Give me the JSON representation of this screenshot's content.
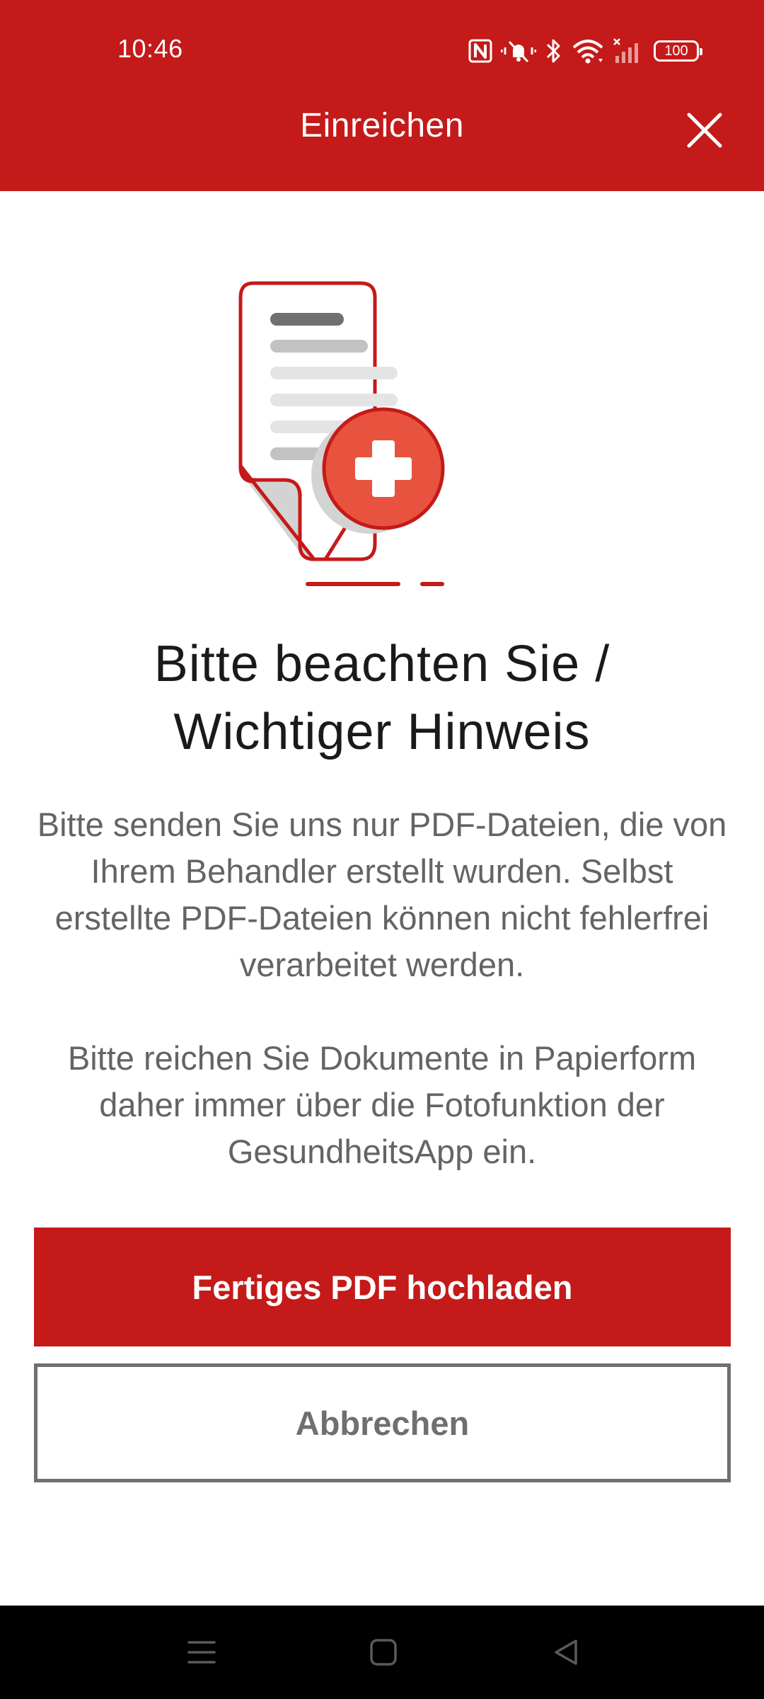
{
  "status_bar": {
    "time": "10:46",
    "battery": "100",
    "icons": [
      "nfc-icon",
      "mute-vibrate-icon",
      "bluetooth-icon",
      "wifi-icon",
      "no-signal-icon",
      "battery-icon"
    ]
  },
  "toolbar": {
    "title": "Einreichen",
    "close_icon": "close-icon"
  },
  "content": {
    "illustration": "document-plus-illustration",
    "headline_line1": "Bitte beachten Sie /",
    "headline_line2": "Wichtiger Hinweis",
    "paragraph1": "Bitte senden Sie uns nur PDF-Dateien, die von Ihrem Behandler erstellt wurden. Selbst erstellte PDF-Dateien können nicht fehlerfrei verarbeitet werden.",
    "paragraph2": "Bitte reichen Sie Dokumente in Papierform daher immer über die Fotofunktion der GesundheitsApp ein."
  },
  "actions": {
    "primary_label": "Fertiges PDF hochladen",
    "secondary_label": "Abbrechen"
  },
  "nav_bar": {
    "items": [
      "menu-icon",
      "home-icon",
      "back-icon"
    ]
  },
  "colors": {
    "brand_red": "#c41a19",
    "accent_red": "#e8533f",
    "text_dark": "#1a1a1a",
    "text_gray": "#646464",
    "button_outline": "#6f6f6f"
  }
}
